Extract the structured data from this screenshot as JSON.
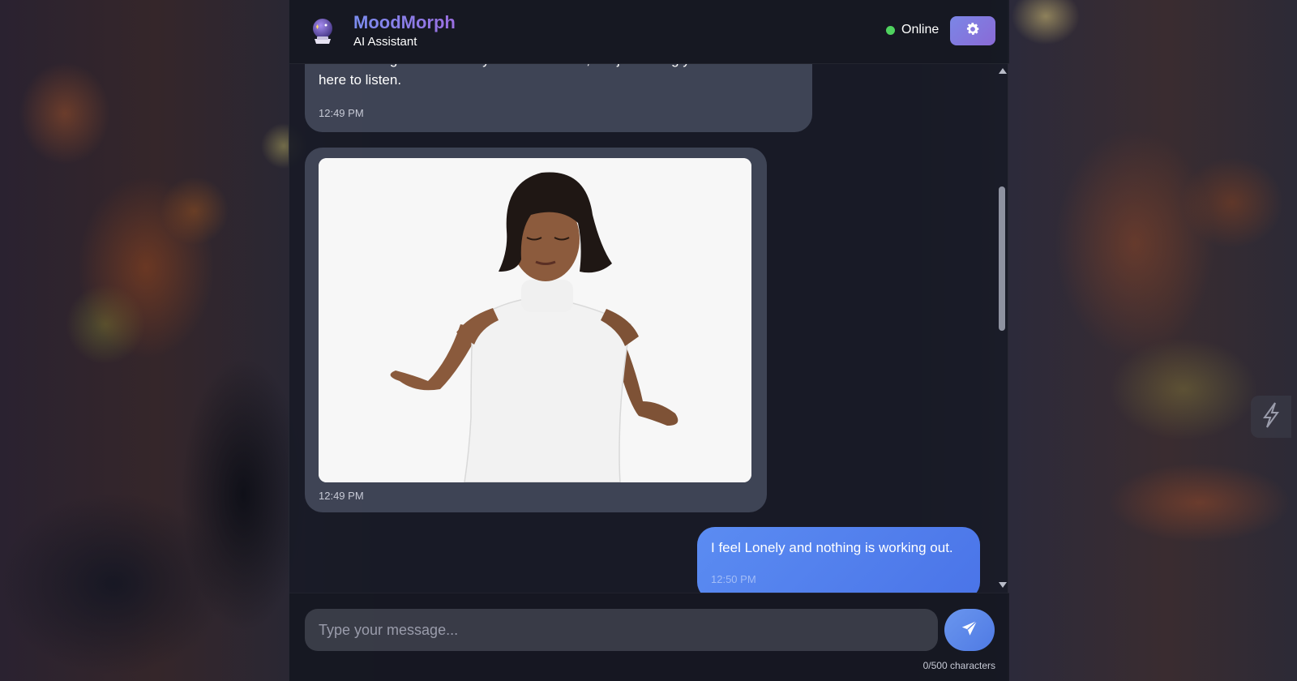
{
  "header": {
    "title": "MoodMorph",
    "subtitle": "AI Assistant",
    "status": "Online",
    "settings_icon": "gear-icon",
    "logo_icon": "crystal-ball-icon"
  },
  "messages": [
    {
      "role": "assistant",
      "text": "No need to go into detail if you don't want to, but just letting you know I'm here to listen.",
      "time": "12:49 PM"
    },
    {
      "role": "assistant",
      "type": "gif",
      "image": "woman-meditating-gif",
      "time": "12:49 PM"
    },
    {
      "role": "user",
      "text": "I feel Lonely and nothing is working out.",
      "time": "12:50 PM"
    }
  ],
  "composer": {
    "placeholder": "Type your message...",
    "value": "",
    "char_count": "0/500 characters",
    "send_icon": "paper-plane-icon"
  },
  "colors": {
    "accent": "#7b86e6",
    "user_bubble": "#5b8cf2",
    "online": "#4fd25f"
  }
}
